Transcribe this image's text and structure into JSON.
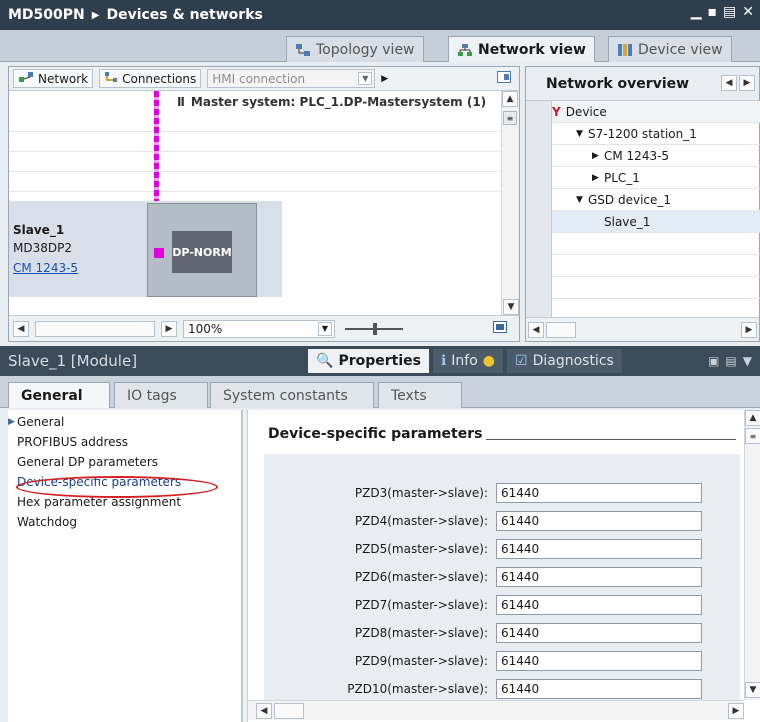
{
  "titlebar": {
    "project": "MD500PN",
    "section": "Devices & networks"
  },
  "view_tabs": [
    "Topology view",
    "Network view",
    "Device view"
  ],
  "network_toolbar": {
    "network_label": "Network",
    "connections_label": "Connections",
    "connection_type": "HMI connection"
  },
  "canvas": {
    "master_system": "Master system: PLC_1.DP-Mastersystem (1)",
    "slave": {
      "name": "Slave_1",
      "type": "MD38DP2",
      "link": "CM 1243-5",
      "module_label": "DP-NORM"
    },
    "zoom": "100%"
  },
  "network_overview": {
    "title": "Network overview",
    "column": "Device",
    "rows": [
      {
        "label": "S7-1200 station_1",
        "level": 1,
        "expander": "open"
      },
      {
        "label": "CM 1243-5",
        "level": 2,
        "expander": "closed"
      },
      {
        "label": "PLC_1",
        "level": 2,
        "expander": "closed"
      },
      {
        "label": "GSD device_1",
        "level": 1,
        "expander": "open"
      },
      {
        "label": "Slave_1",
        "level": 2,
        "expander": "none"
      }
    ]
  },
  "inspector": {
    "module_title": "Slave_1 [Module]",
    "tabs": [
      "Properties",
      "Info",
      "Diagnostics"
    ],
    "subtabs": [
      "General",
      "IO tags",
      "System constants",
      "Texts"
    ]
  },
  "left_nav": [
    "General",
    "PROFIBUS address",
    "General DP parameters",
    "Device-specific parameters",
    "Hex parameter assignment",
    "Watchdog"
  ],
  "content": {
    "title": "Device-specific parameters",
    "params": [
      {
        "label": "PZD3(master->slave):",
        "value": "61440"
      },
      {
        "label": "PZD4(master->slave):",
        "value": "61440"
      },
      {
        "label": "PZD5(master->slave):",
        "value": "61440"
      },
      {
        "label": "PZD6(master->slave):",
        "value": "61440"
      },
      {
        "label": "PZD7(master->slave):",
        "value": "61440"
      },
      {
        "label": "PZD8(master->slave):",
        "value": "61440"
      },
      {
        "label": "PZD9(master->slave):",
        "value": "61440"
      },
      {
        "label": "PZD10(master->slave):",
        "value": "61440"
      }
    ]
  }
}
